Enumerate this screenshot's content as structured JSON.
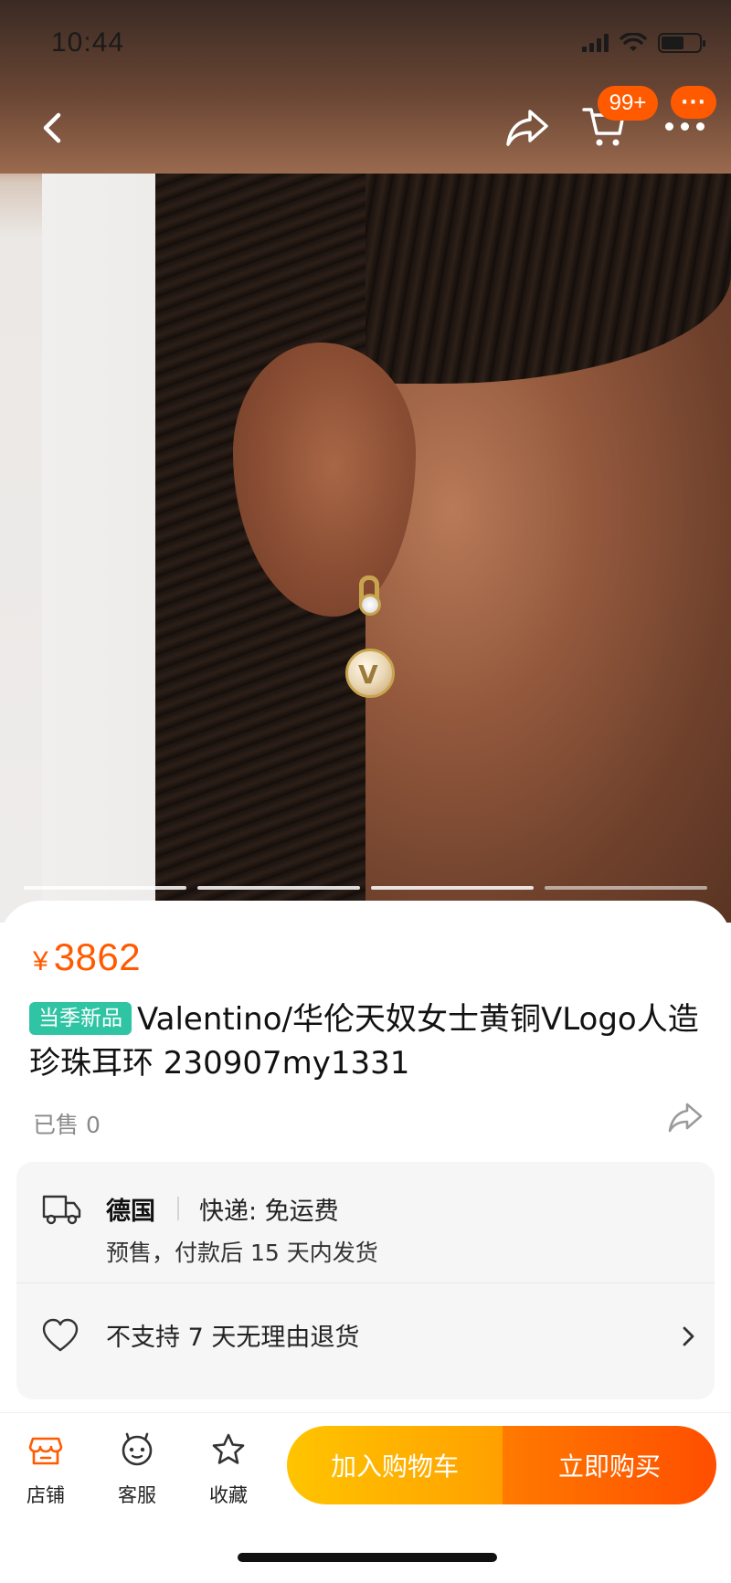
{
  "status_bar": {
    "time": "10:44"
  },
  "nav": {
    "cart_badge": "99+",
    "more_badge": "···"
  },
  "product": {
    "currency": "¥",
    "price": "3862",
    "tag": "当季新品",
    "title": "Valentino/华伦天奴女士黄铜VLogo人造珍珠耳环 230907my1331",
    "sold": "已售 0"
  },
  "shipping": {
    "origin": "德国",
    "express": "快递: 免运费",
    "presale": "预售，付款后 15 天内发货",
    "returns": "不支持 7 天无理由退货"
  },
  "bottom_bar": {
    "tabs": [
      {
        "label": "店铺",
        "icon": "store-icon"
      },
      {
        "label": "客服",
        "icon": "customer-service-icon"
      },
      {
        "label": "收藏",
        "icon": "star-icon"
      }
    ],
    "add_to_cart": "加入购物车",
    "buy_now": "立即购买"
  },
  "carousel": {
    "count": 4,
    "active": 1
  },
  "colors": {
    "accent": "#ff5a00",
    "tag": "#2fc4a3",
    "cart_button": "#ffb000",
    "buy_button": "#ff6000"
  }
}
